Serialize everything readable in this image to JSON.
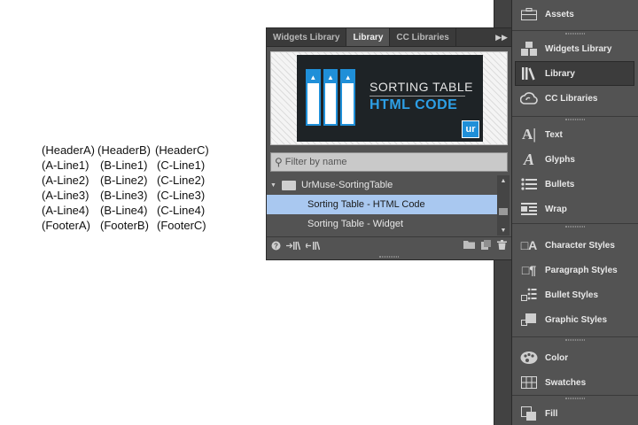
{
  "canvas_table": {
    "rows": [
      [
        "(HeaderA)",
        "(HeaderB)",
        "(HeaderC)"
      ],
      [
        "(A-Line1)",
        "(B-Line1)",
        "(C-Line1)"
      ],
      [
        "(A-Line2)",
        "(B-Line2)",
        "(C-Line2)"
      ],
      [
        "(A-Line3)",
        "(B-Line3)",
        "(C-Line3)"
      ],
      [
        "(A-Line4)",
        "(B-Line4)",
        "(C-Line4)"
      ],
      [
        "(FooterA)",
        "(FooterB)",
        "(FooterC)"
      ]
    ]
  },
  "library_panel": {
    "tabs": [
      "Widgets Library",
      "Library",
      "CC Libraries"
    ],
    "active_tab": "Library",
    "preview": {
      "title_line1": "SORTING TABLE",
      "title_line2": "HTML CODE",
      "logo": "ur"
    },
    "filter_placeholder": "Filter by name",
    "folder": "UrMuse-SortingTable",
    "items": [
      "Sorting Table - HTML Code",
      "Sorting Table - Widget"
    ],
    "selected_item": "Sorting Table - HTML Code"
  },
  "right_panel": {
    "items": {
      "assets": "Assets",
      "widgets_library": "Widgets Library",
      "library": "Library",
      "cc_libraries": "CC Libraries",
      "text": "Text",
      "glyphs": "Glyphs",
      "bullets": "Bullets",
      "wrap": "Wrap",
      "character_styles": "Character Styles",
      "paragraph_styles": "Paragraph Styles",
      "bullet_styles": "Bullet Styles",
      "graphic_styles": "Graphic Styles",
      "color": "Color",
      "swatches": "Swatches",
      "fill": "Fill"
    },
    "active": "Library"
  },
  "colors": {
    "panel_bg": "#535353",
    "selection": "#a9c8f0",
    "thumb_accent": "#1f8fd8"
  }
}
